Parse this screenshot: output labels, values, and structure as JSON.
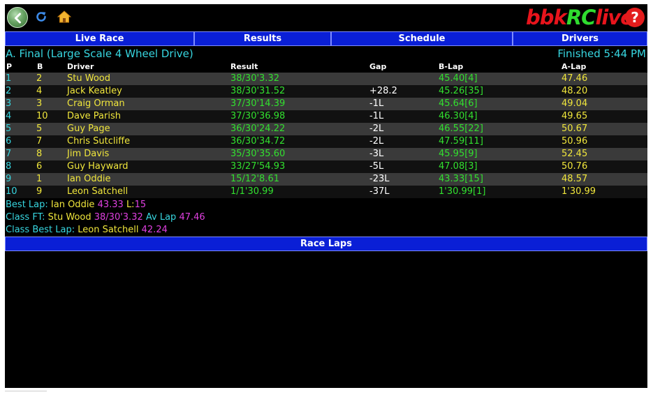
{
  "toolbar": {
    "back_icon": "back-arrow-icon",
    "refresh_icon": "refresh-icon",
    "home_icon": "home-icon",
    "help_label": "?"
  },
  "logo": {
    "part1": "bbk",
    "part2": "RC",
    "part3": "live"
  },
  "colors": {
    "background": "#000000",
    "nav_blue": "#0a1fd6",
    "cyan": "#37d6e0",
    "yellow": "#f0e63c",
    "green": "#32e02f",
    "magenta": "#e040e0",
    "red": "#e8141c",
    "row_alt": "#3a3a3a"
  },
  "nav": {
    "tabs": [
      {
        "label": "Live Race"
      },
      {
        "label": "Results"
      },
      {
        "label": "Schedule"
      },
      {
        "label": "Drivers"
      }
    ]
  },
  "race": {
    "title": "A. Final (Large Scale 4 Wheel Drive)",
    "status": "Finished 5:44 PM"
  },
  "table": {
    "headers": {
      "pos": "P",
      "bib": "B",
      "driver": "Driver",
      "result": "Result",
      "gap": "Gap",
      "blap": "B-Lap",
      "alap": "A-Lap"
    },
    "rows": [
      {
        "pos": "1",
        "bib": "2",
        "driver": "Stu Wood",
        "result": "38/30'3.32",
        "gap": "",
        "blap": "45.40[4]",
        "alap": "47.46"
      },
      {
        "pos": "2",
        "bib": "4",
        "driver": "Jack Keatley",
        "result": "38/30'31.52",
        "gap": "+28.2",
        "blap": "45.26[35]",
        "alap": "48.20"
      },
      {
        "pos": "3",
        "bib": "3",
        "driver": "Craig Orman",
        "result": "37/30'14.39",
        "gap": "-1L",
        "blap": "45.64[6]",
        "alap": "49.04"
      },
      {
        "pos": "4",
        "bib": "10",
        "driver": "Dave Parish",
        "result": "37/30'36.98",
        "gap": "-1L",
        "blap": "46.30[4]",
        "alap": "49.65"
      },
      {
        "pos": "5",
        "bib": "5",
        "driver": "Guy Page",
        "result": "36/30'24.22",
        "gap": "-2L",
        "blap": "46.55[22]",
        "alap": "50.67"
      },
      {
        "pos": "6",
        "bib": "7",
        "driver": "Chris Sutcliffe",
        "result": "36/30'34.72",
        "gap": "-2L",
        "blap": "47.59[11]",
        "alap": "50.96"
      },
      {
        "pos": "7",
        "bib": "8",
        "driver": "Jim Davis",
        "result": "35/30'35.60",
        "gap": "-3L",
        "blap": "45.95[9]",
        "alap": "52.45"
      },
      {
        "pos": "8",
        "bib": "6",
        "driver": "Guy Hayward",
        "result": "33/27'54.93",
        "gap": "-5L",
        "blap": "47.08[3]",
        "alap": "50.76"
      },
      {
        "pos": "9",
        "bib": "1",
        "driver": "Ian Oddie",
        "result": "15/12'8.61",
        "gap": "-23L",
        "blap": "43.33[15]",
        "alap": "48.57"
      },
      {
        "pos": "10",
        "bib": "9",
        "driver": "Leon Satchell",
        "result": "1/1'30.99",
        "gap": "-37L",
        "blap": "1'30.99[1]",
        "alap": "1'30.99"
      }
    ]
  },
  "stats": {
    "best_lap": {
      "label": "Best Lap:",
      "driver": "Ian Oddie",
      "time": "43.33",
      "lap_label": "L:",
      "lap": "15"
    },
    "class_ft": {
      "label": "Class FT:",
      "driver": "Stu Wood",
      "result": "38/30'3.32",
      "avg_label": "Av Lap",
      "avg": "47.46"
    },
    "class_best": {
      "label": "Class Best Lap:",
      "driver": "Leon Satchell",
      "time": "42.24"
    }
  },
  "race_laps": {
    "label": "Race Laps"
  }
}
